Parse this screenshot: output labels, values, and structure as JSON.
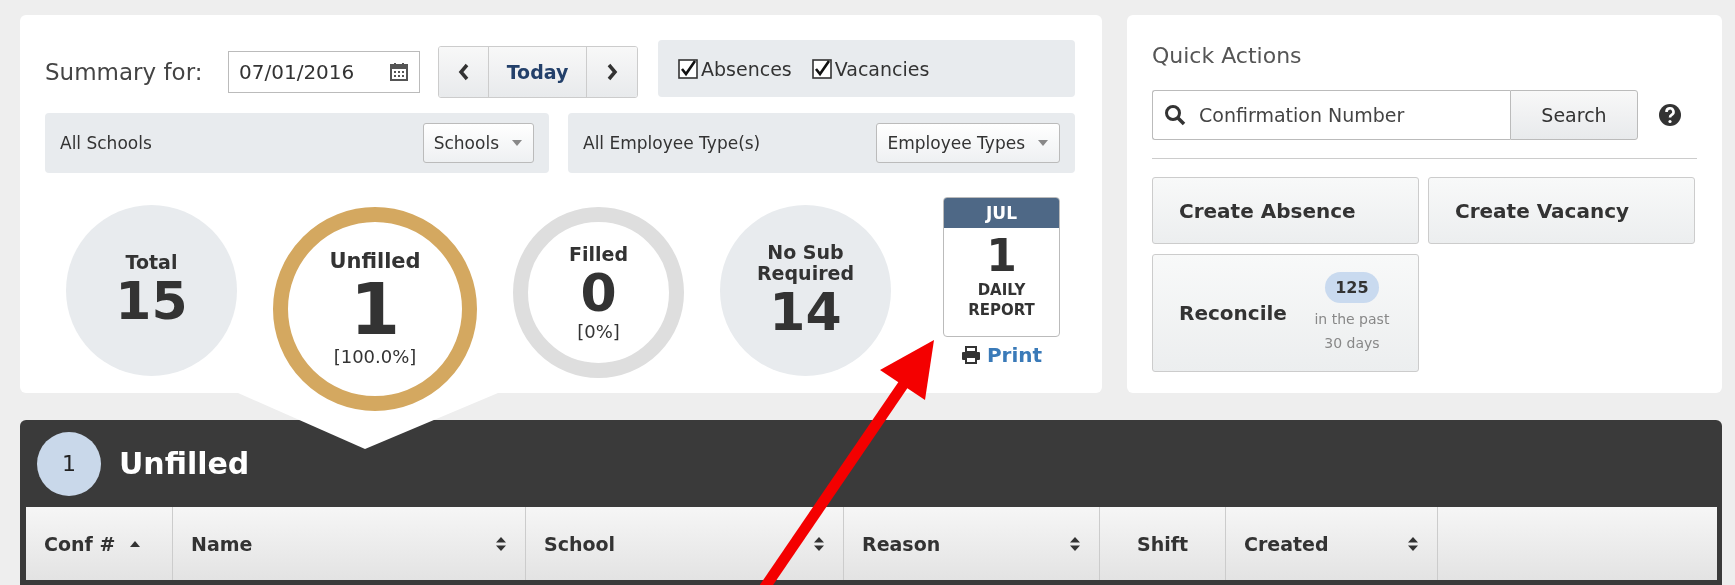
{
  "summary": {
    "label": "Summary for:",
    "date": "07/01/2016",
    "today": "Today"
  },
  "checkboxes": [
    {
      "label": "Absences",
      "checked": true
    },
    {
      "label": "Vacancies",
      "checked": true
    }
  ],
  "filters": [
    {
      "value": "All Schools",
      "button": "Schools"
    },
    {
      "value": "All Employee Type(s)",
      "button": "Employee Types"
    }
  ],
  "stats": [
    {
      "kind": "plain",
      "label": "Total",
      "value": "15"
    },
    {
      "kind": "ring",
      "label": "Unfilled",
      "value": "1",
      "percent": "[100.0%]",
      "selected": true
    },
    {
      "kind": "ring",
      "label": "Filled",
      "value": "0",
      "percent": "[0%]",
      "selected": false
    },
    {
      "kind": "plain",
      "label": "No Sub Required",
      "value": "14"
    }
  ],
  "daily_report": {
    "month": "JUL",
    "day": "1",
    "label": "DAILY REPORT",
    "print": "Print"
  },
  "quick_actions": {
    "title": "Quick Actions",
    "search_placeholder": "Confirmation Number",
    "search_button": "Search",
    "buttons": [
      {
        "label": "Create Absence"
      },
      {
        "label": "Create Vacancy"
      }
    ],
    "reconcile": {
      "label": "Reconcile",
      "count": "125",
      "note": "in the past 30 days"
    }
  },
  "panel": {
    "count": "1",
    "title": "Unfilled",
    "columns": [
      {
        "label": "Conf #",
        "sorted": true,
        "sortable": true
      },
      {
        "label": "Name",
        "sorted": false,
        "sortable": true
      },
      {
        "label": "School",
        "sorted": false,
        "sortable": true
      },
      {
        "label": "Reason",
        "sorted": false,
        "sortable": true
      },
      {
        "label": "Shift",
        "sorted": false,
        "sortable": false
      },
      {
        "label": "Created",
        "sorted": false,
        "sortable": true
      }
    ]
  }
}
